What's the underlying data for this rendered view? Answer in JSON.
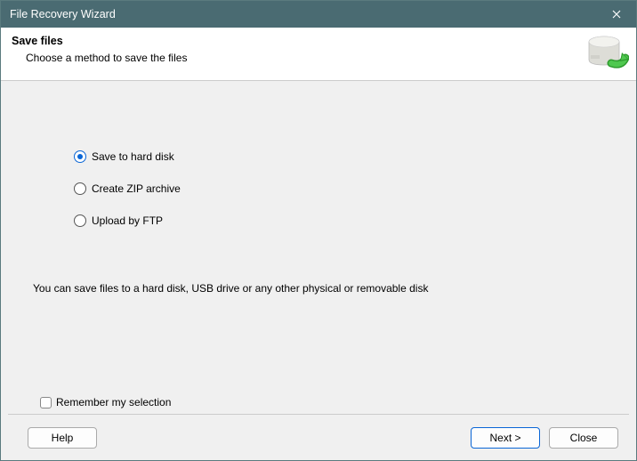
{
  "window": {
    "title": "File Recovery Wizard"
  },
  "header": {
    "title": "Save files",
    "subtitle": "Choose a method to save the files"
  },
  "options": [
    {
      "label": "Save to hard disk",
      "selected": true
    },
    {
      "label": "Create ZIP archive",
      "selected": false
    },
    {
      "label": "Upload by FTP",
      "selected": false
    }
  ],
  "hint": "You can save files to a hard disk, USB drive or any other physical or removable disk",
  "remember": {
    "label": "Remember my selection",
    "checked": false
  },
  "buttons": {
    "help": "Help",
    "next": "Next >",
    "close": "Close"
  }
}
